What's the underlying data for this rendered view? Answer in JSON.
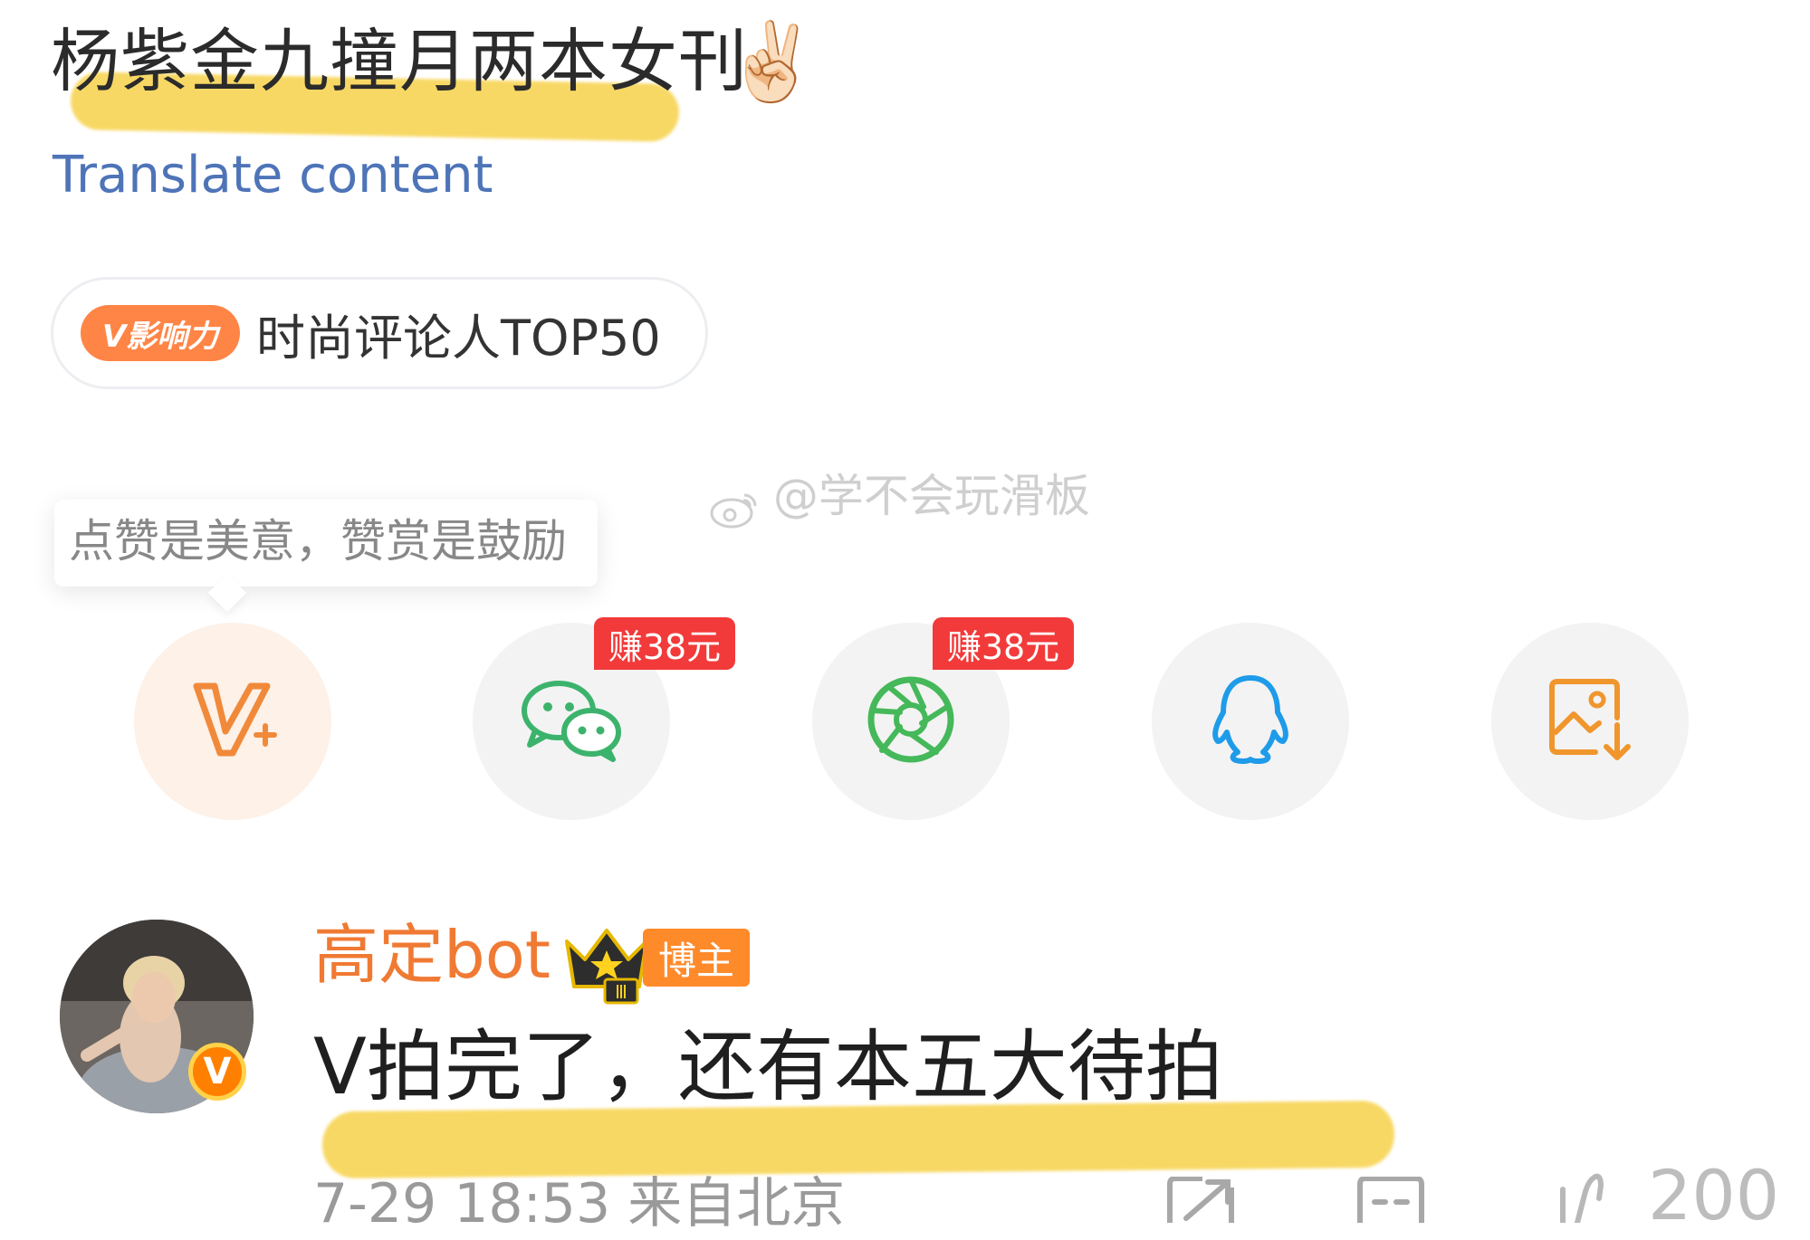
{
  "post": {
    "title": "杨紫金九撞月两本女刊",
    "emoji": "✌🏻",
    "translate_link": "Translate content"
  },
  "influence": {
    "badge": "V影响力",
    "label": "时尚评论人TOP50"
  },
  "tip": {
    "text": "点赞是美意，赞赏是鼓励"
  },
  "watermark": "@学不会玩滑板",
  "share": {
    "items": [
      {
        "icon": "vip-plus-icon",
        "reward": ""
      },
      {
        "icon": "wechat-icon",
        "reward": "赚38元"
      },
      {
        "icon": "moments-icon",
        "reward": "赚38元"
      },
      {
        "icon": "qq-icon",
        "reward": ""
      },
      {
        "icon": "save-image-icon",
        "reward": ""
      }
    ]
  },
  "comment": {
    "author": "高定bot",
    "verified_mark": "V",
    "crown_level": "Ⅲ",
    "role_badge": "博主",
    "text": "V拍完了，还有本五大待拍",
    "meta": "7-29 18:53  来自北京",
    "like_count": "200"
  },
  "colors": {
    "accent_orange": "#f07a33",
    "link_blue": "#4e74b8",
    "reward_red": "#f23a3a",
    "highlight_yellow": "#f7d24a"
  }
}
